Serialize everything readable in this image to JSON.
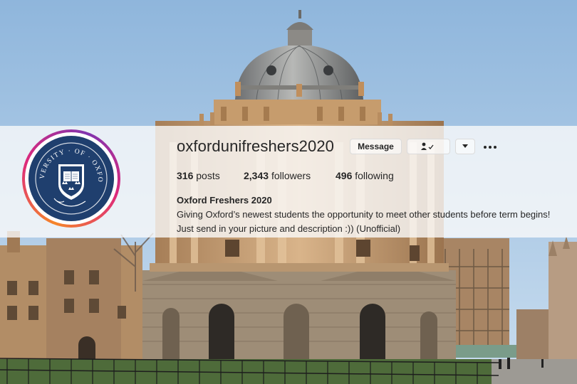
{
  "profile": {
    "username": "oxfordunifreshers2020",
    "message_label": "Message",
    "posts_count": "316",
    "posts_label": "posts",
    "followers_count": "2,343",
    "followers_label": "followers",
    "following_count": "496",
    "following_label": "following",
    "full_name": "Oxford Freshers 2020",
    "bio": "Giving Oxford’s newest students the opportunity to meet other students before term begins! Just send in your picture and description :)) (Unofficial)",
    "avatar_text": "UNIVERSITY OF OXFORD",
    "avatar_book_text": "DOMINUS ILLUMINATIO MEA"
  },
  "colors": {
    "sky": "#a9c8e6",
    "stone": "#c7a27a",
    "avatar_navy": "#1f3f6e",
    "ring_gradient": [
      "#f58529",
      "#dd2a7b",
      "#8134af"
    ]
  },
  "icons": {
    "follow": "person-check-icon",
    "dropdown": "caret-down-icon",
    "more": "more-dots-icon"
  }
}
